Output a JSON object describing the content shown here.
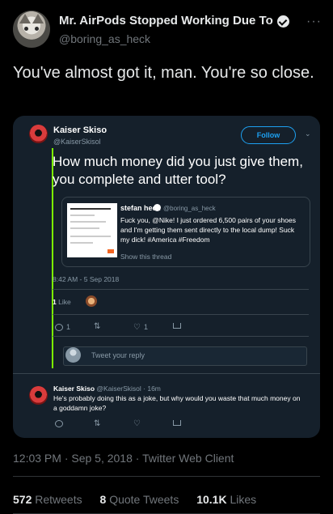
{
  "author": {
    "display_name": "Mr. AirPods Stopped Working Due To E...",
    "handle": "@boring_as_heck",
    "more_icon": "more-horizontal-icon"
  },
  "tweet_text": "You've almost got it, man. You're so close.",
  "embedded": {
    "user_name": "Kaiser Skiso",
    "user_handle": "@KaiserSkisol",
    "follow_label": "Follow",
    "main_text": "How much money did you just give them, you complete and utter tool?",
    "quoted": {
      "name": "stefan heck",
      "handle": "@boring_as_heck",
      "text": "Fuck you, @Nike! I just ordered 6,500 pairs of your shoes and I'm getting them sent directly to the local dump! Suck my dick! #America #Freedom",
      "show_thread": "Show this thread"
    },
    "timestamp": "8:42 AM - 5 Sep 2018",
    "likes_count": "1",
    "likes_label": "Like",
    "actions": {
      "reply_count": "1",
      "like_count": "1"
    },
    "reply_placeholder": "Tweet your reply",
    "reply": {
      "name": "Kaiser Skiso",
      "handle_time": "@KaiserSkisol · 16m",
      "text": "He's probably doing this as a joke, but why would you waste that much money on a goddamn joke?"
    }
  },
  "meta": "12:03 PM · Sep 5, 2018 · Twitter Web Client",
  "stats": {
    "retweets_count": "572",
    "retweets_label": "Retweets",
    "quotes_count": "8",
    "quotes_label": "Quote Tweets",
    "likes_count": "10.1K",
    "likes_label": "Likes"
  },
  "colors": {
    "background": "#000000",
    "card": "#15202b",
    "accent": "#1da1f2",
    "thread_line": "#7cfc00"
  }
}
